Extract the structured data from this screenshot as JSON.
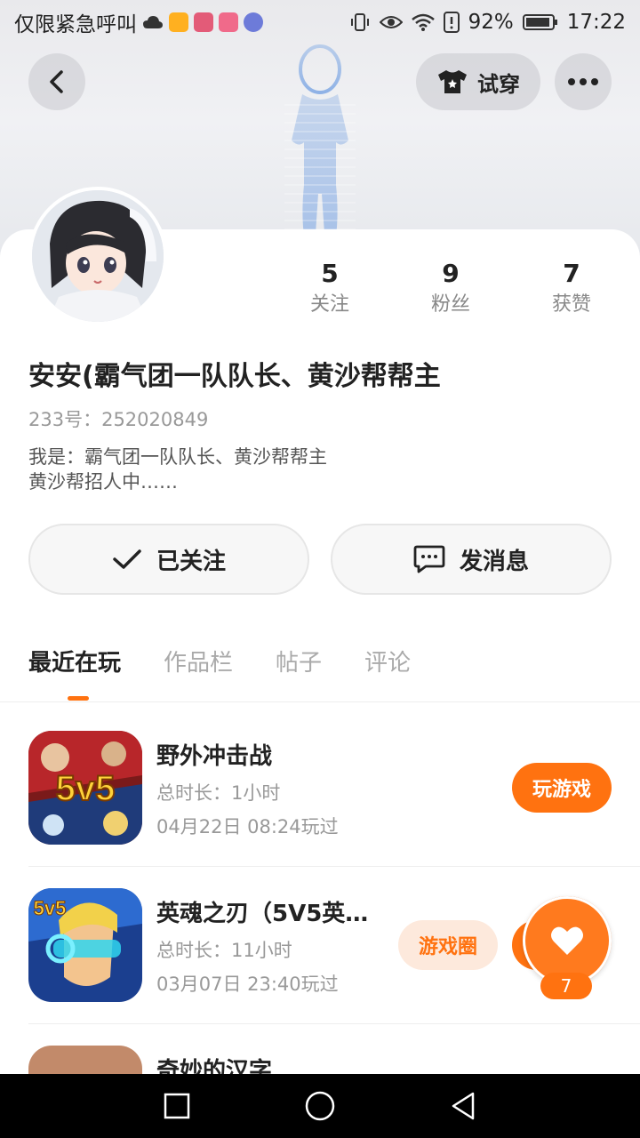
{
  "status_bar": {
    "carrier": "仅限紧急呼叫",
    "battery": "92%",
    "time": "17:22"
  },
  "header": {
    "back_icon": "chevron-left-icon",
    "try_on_label": "试穿",
    "more_icon": "more-dots-icon"
  },
  "profile": {
    "name": "安安(霸气团一队队长、黄沙帮帮主",
    "uid": "233号：252020849",
    "bio_line1": "我是：霸气团一队队长、黄沙帮帮主",
    "bio_line2": "黄沙帮招人中……",
    "stats": [
      {
        "value": "5",
        "label": "关注"
      },
      {
        "value": "9",
        "label": "粉丝"
      },
      {
        "value": "7",
        "label": "获赞"
      }
    ]
  },
  "actions": {
    "follow_label": "已关注",
    "message_label": "发消息"
  },
  "tabs": [
    {
      "label": "最近在玩",
      "active": true
    },
    {
      "label": "作品栏",
      "active": false
    },
    {
      "label": "帖子",
      "active": false
    },
    {
      "label": "评论",
      "active": false
    }
  ],
  "games": [
    {
      "title": "野外冲击战",
      "duration": "总时长：1小时",
      "last_played": "04月22日 08:24玩过",
      "button": "玩游戏",
      "icon_text": "5v5"
    },
    {
      "title": "英魂之刃（5V5英…",
      "duration": "总时长：11小时",
      "last_played": "03月07日 23:40玩过",
      "button": "游戏圈",
      "icon_text": "5v5"
    },
    {
      "title": "奇妙的汉字"
    }
  ],
  "fab": {
    "likes": "7"
  },
  "colors": {
    "accent": "#ff7210",
    "accent_light": "#fde9dc"
  }
}
